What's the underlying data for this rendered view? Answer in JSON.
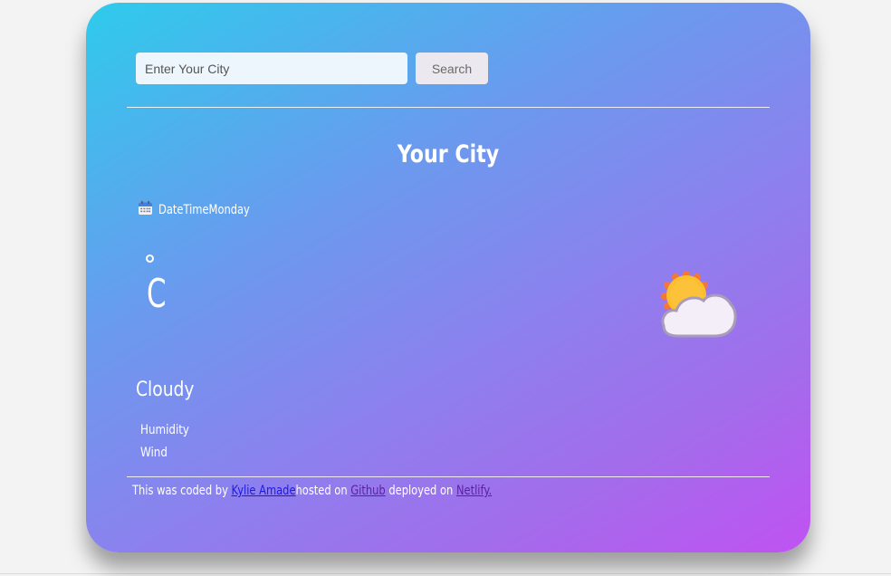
{
  "search": {
    "placeholder": "Enter Your City",
    "button_label": "Search"
  },
  "weather": {
    "city": "Your City",
    "date_icon": "calendar-icon",
    "date_text": "DateTimeMonday",
    "temperature_unit": "C",
    "condition_icon": "partly-cloudy-icon",
    "condition": "Cloudy",
    "humidity_label": "Humidity",
    "wind_label": "Wind"
  },
  "footer": {
    "prefix": "This was coded by ",
    "author_link": "Kylie Amade",
    "hosted_text": "hosted on ",
    "github_link": "Github",
    "deployed_text": " deployed on ",
    "netlify_link": "Netlify."
  },
  "colors": {
    "gradient_start": "#2ecbec",
    "gradient_end": "#c052f2",
    "link_author": "#1a1ae8",
    "link_visited": "#5b1fa0"
  }
}
